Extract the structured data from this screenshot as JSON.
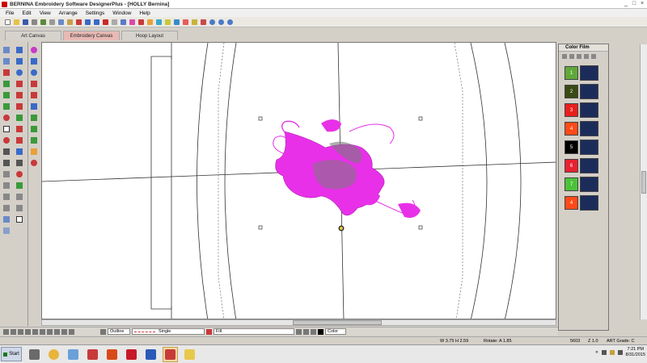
{
  "window": {
    "title": "BERNINA Embroidery Software DesignerPlus - [HOLLY      Bernina]",
    "controls": [
      "_",
      "□",
      "×"
    ]
  },
  "menu": [
    "File",
    "Edit",
    "View",
    "Arrange",
    "Settings",
    "Window",
    "Help"
  ],
  "tabs": [
    {
      "label": "Art Canvas"
    },
    {
      "label": "Embroidery Canvas",
      "active": true
    },
    {
      "label": "Hoop Layout"
    }
  ],
  "color_film": {
    "title": "Color Film",
    "items": [
      {
        "num": "1",
        "color": "#5fa83a"
      },
      {
        "num": "2",
        "color": "#3a4a14"
      },
      {
        "num": "3",
        "color": "#e8201c"
      },
      {
        "num": "4",
        "color": "#ff4a18"
      },
      {
        "num": "5",
        "color": "#000000"
      },
      {
        "num": "6",
        "color": "#e82030"
      },
      {
        "num": "7",
        "color": "#4cc23a"
      },
      {
        "num": "4",
        "color": "#ff4a18"
      }
    ]
  },
  "bottom_toolbar": {
    "outline_label": "Outline",
    "line_type": "Single",
    "fill_label": "Fill",
    "color_label": "Color"
  },
  "status": {
    "dims": "W 3.75  H 2.59",
    "rotate": "Rotate: A   1.85",
    "stitch_count": "5603",
    "zoom": "Z 1.0",
    "art_grade": "ART Grade: C"
  },
  "taskbar": {
    "start_label": "Start",
    "time": "7:21 PM",
    "date": "8/31/2015"
  },
  "colors": {
    "stitch_magenta": "#e830e8",
    "stitch_gray": "#7a7a7a"
  }
}
